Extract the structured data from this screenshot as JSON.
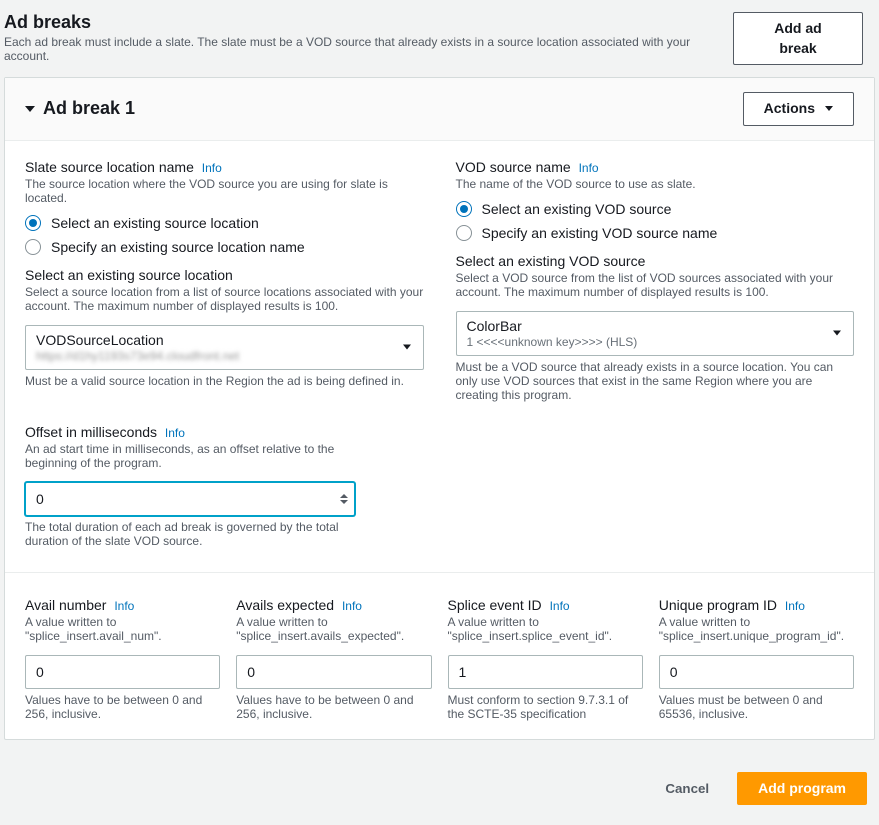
{
  "header": {
    "title": "Ad breaks",
    "subtitle": "Each ad break must include a slate. The slate must be a VOD source that already exists in a source location associated with your account.",
    "add_button": "Add ad break"
  },
  "panel": {
    "title": "Ad break 1",
    "actions_label": "Actions"
  },
  "slate": {
    "label": "Slate source location name",
    "info": "Info",
    "desc": "The source location where the VOD source you are using for slate is located.",
    "radio1": "Select an existing source location",
    "radio2": "Specify an existing source location name",
    "select_label": "Select an existing source location",
    "select_desc": "Select a source location from a list of source locations associated with your account. The maximum number of displayed results is 100.",
    "selected_primary": "VODSourceLocation",
    "selected_secondary": "https://d1hy1193s73e94.cloudfront.net",
    "select_hint": "Must be a valid source location in the Region the ad is being defined in."
  },
  "vod": {
    "label": "VOD source name",
    "info": "Info",
    "desc": "The name of the VOD source to use as slate.",
    "radio1": "Select an existing VOD source",
    "radio2": "Specify an existing VOD source name",
    "select_label": "Select an existing VOD source",
    "select_desc": "Select a VOD source from the list of VOD sources associated with your account. The maximum number of displayed results is 100.",
    "selected_primary": "ColorBar",
    "selected_secondary": "1 <<<<unknown key>>>> (HLS)",
    "select_hint": "Must be a VOD source that already exists in a source location. You can only use VOD sources that exist in the same Region where you are creating this program."
  },
  "offset": {
    "label": "Offset in milliseconds",
    "info": "Info",
    "desc": "An ad start time in milliseconds, as an offset relative to the beginning of the program.",
    "value": "0",
    "hint": "The total duration of each ad break is governed by the total duration of the slate VOD source."
  },
  "avail_number": {
    "label": "Avail number",
    "info": "Info",
    "desc": "A value written to \"splice_insert.avail_num\".",
    "value": "0",
    "hint": "Values have to be between 0 and 256, inclusive."
  },
  "avails_expected": {
    "label": "Avails expected",
    "info": "Info",
    "desc": "A value written to \"splice_insert.avails_expected\".",
    "value": "0",
    "hint": "Values have to be between 0 and 256, inclusive."
  },
  "splice_event_id": {
    "label": "Splice event ID",
    "info": "Info",
    "desc": "A value written to \"splice_insert.splice_event_id\".",
    "value": "1",
    "hint": "Must conform to section 9.7.3.1 of the SCTE-35 specification"
  },
  "unique_program_id": {
    "label": "Unique program ID",
    "info": "Info",
    "desc": "A value written to \"splice_insert.unique_program_id\".",
    "value": "0",
    "hint": "Values must be between 0 and 65536, inclusive."
  },
  "footer": {
    "cancel": "Cancel",
    "add_program": "Add program"
  }
}
